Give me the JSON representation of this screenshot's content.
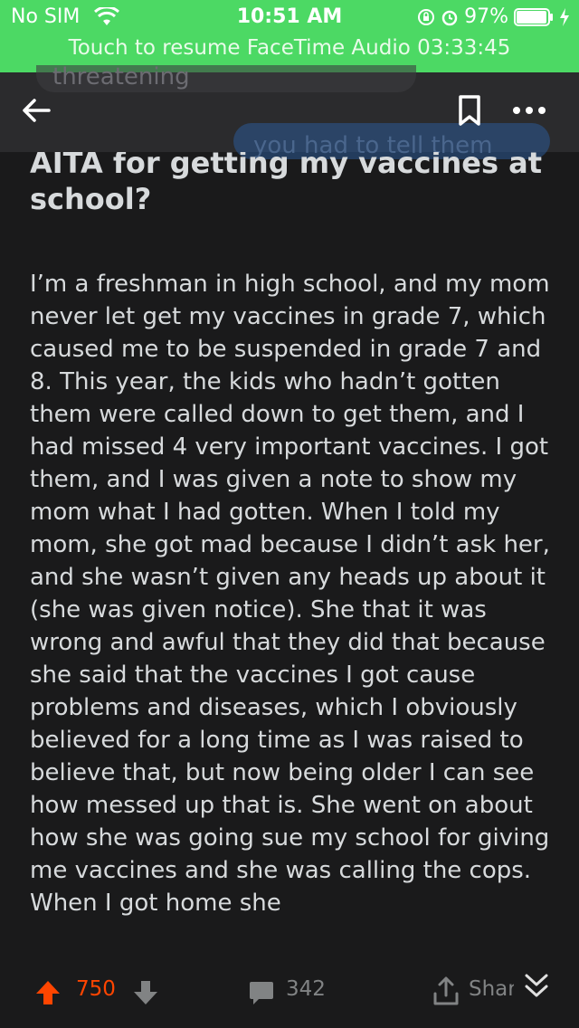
{
  "status_bar": {
    "carrier": "No SIM",
    "time": "10:51 AM",
    "battery": "97%",
    "battery_level": 0.97,
    "banner": "Touch to resume FaceTime Audio 03:33:45"
  },
  "header": {
    "ghost_text_top": "threatening",
    "ghost_text_bubble": "you had to tell them",
    "icons": [
      "back-arrow-icon",
      "bookmark-icon",
      "more-icon"
    ]
  },
  "post": {
    "title": "AITA for getting my vaccines at school?",
    "body": "I’m a freshman in high school, and my mom never let get my vaccines in grade 7, which caused me to be suspended in grade 7 and 8. This year, the kids who hadn’t gotten them were called down to get them, and I had missed 4 very important vaccines. I got them, and I was given a note to show my mom what I had gotten. When I told my mom, she got mad because I didn’t ask her, and she wasn’t given any heads up about it (she was given notice). She that it was wrong and awful that they did that because she said that the vaccines I got cause problems and diseases, which I obviously believed for a long time as I was raised to believe that, but now being older I can see how messed up that is. She went on about how she was going sue my school for giving me vaccines and she was calling the cops. When I got home she"
  },
  "actions": {
    "votes": "750",
    "comments": "342",
    "share_label": "Share"
  },
  "colors": {
    "status_green": "#4cd964",
    "background": "#1a1a1b",
    "upvote": "#ff4500",
    "muted": "#818384",
    "text": "#d7dadc"
  }
}
